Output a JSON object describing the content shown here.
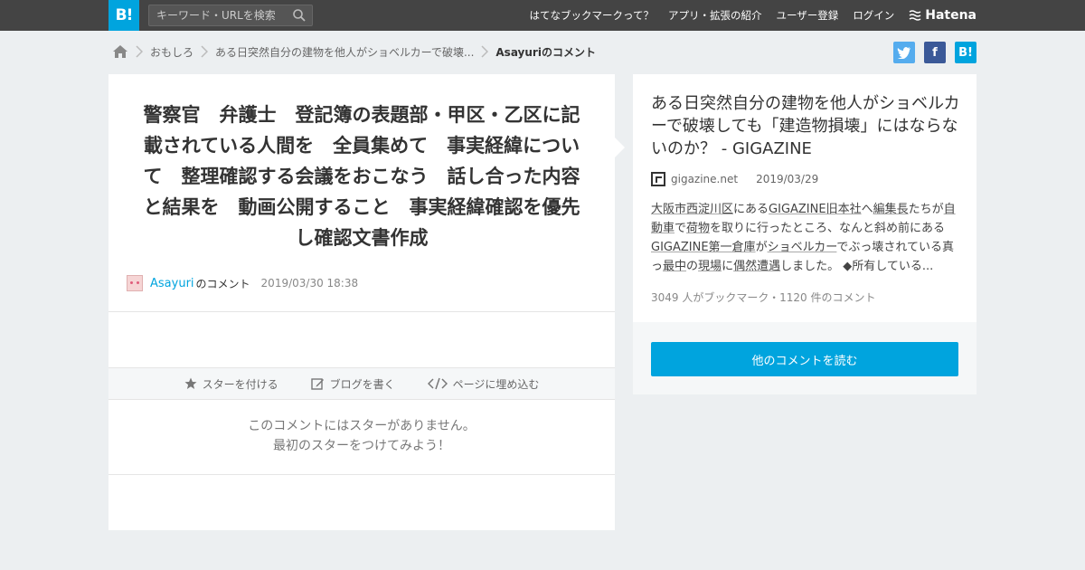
{
  "header": {
    "logo_text": "B!",
    "search_placeholder": "キーワード・URLを検索",
    "nav": [
      "はてなブックマークって？",
      "アプリ・拡張の紹介",
      "ユーザー登録",
      "ログイン"
    ],
    "brand": "Hatena"
  },
  "breadcrumb": {
    "items": [
      "おもしろ",
      "ある日突然自分の建物を他人がショベルカーで破壊..."
    ],
    "current": "Asayuriのコメント"
  },
  "share": {
    "hatena_label": "B!",
    "facebook_label": "f"
  },
  "comment": {
    "text": "警察官　弁護士　登記簿の表題部・甲区・乙区に記載されている人間を　全員集めて　事実経緯について　整理確認する会議をおこなう　話し合った内容と結果を　動画公開すること　事実経緯確認を優先し確認文書作成",
    "user": "Asayuri",
    "note": "のコメント",
    "date": "2019/03/30 18:38",
    "actions": [
      "スターを付ける",
      "ブログを書く",
      "ページに埋め込む"
    ],
    "no_star_line1": "このコメントにはスターがありません。",
    "no_star_line2": "最初のスターをつけてみよう！"
  },
  "entry": {
    "title": "ある日突然自分の建物を他人がショベルカーで破壊しても「建造物損壊」にはならないのか？ - GIGAZINE",
    "site": "gigazine.net",
    "date": "2019/03/29",
    "summary_parts": [
      {
        "text": "大阪市西淀川区",
        "link": true
      },
      {
        "text": "にある",
        "link": false
      },
      {
        "text": "GIGAZINE旧本社",
        "link": true
      },
      {
        "text": "へ",
        "link": false
      },
      {
        "text": "編集長",
        "link": true
      },
      {
        "text": "たちが",
        "link": false
      },
      {
        "text": "自動車",
        "link": true
      },
      {
        "text": "で",
        "link": false
      },
      {
        "text": "荷物",
        "link": true
      },
      {
        "text": "を取りに行ったところ、なんと斜め前にある",
        "link": false
      },
      {
        "text": "GIGAZINE第一倉庫",
        "link": true
      },
      {
        "text": "が",
        "link": false
      },
      {
        "text": "ショベルカー",
        "link": true
      },
      {
        "text": "でぶっ壊されている真っ",
        "link": false
      },
      {
        "text": "最中",
        "link": true
      },
      {
        "text": "の",
        "link": false
      },
      {
        "text": "現場",
        "link": true
      },
      {
        "text": "に",
        "link": false
      },
      {
        "text": "偶然",
        "link": true
      },
      {
        "text": "遭遇",
        "link": true
      },
      {
        "text": "しました。 ◆所有している...",
        "link": false
      }
    ],
    "counts": "3049 人がブックマーク・1120 件のコメント",
    "more_button": "他のコメントを読む"
  },
  "colors": {
    "accent": "#00a4de",
    "topbar": "#444444",
    "background": "#eceff1"
  }
}
